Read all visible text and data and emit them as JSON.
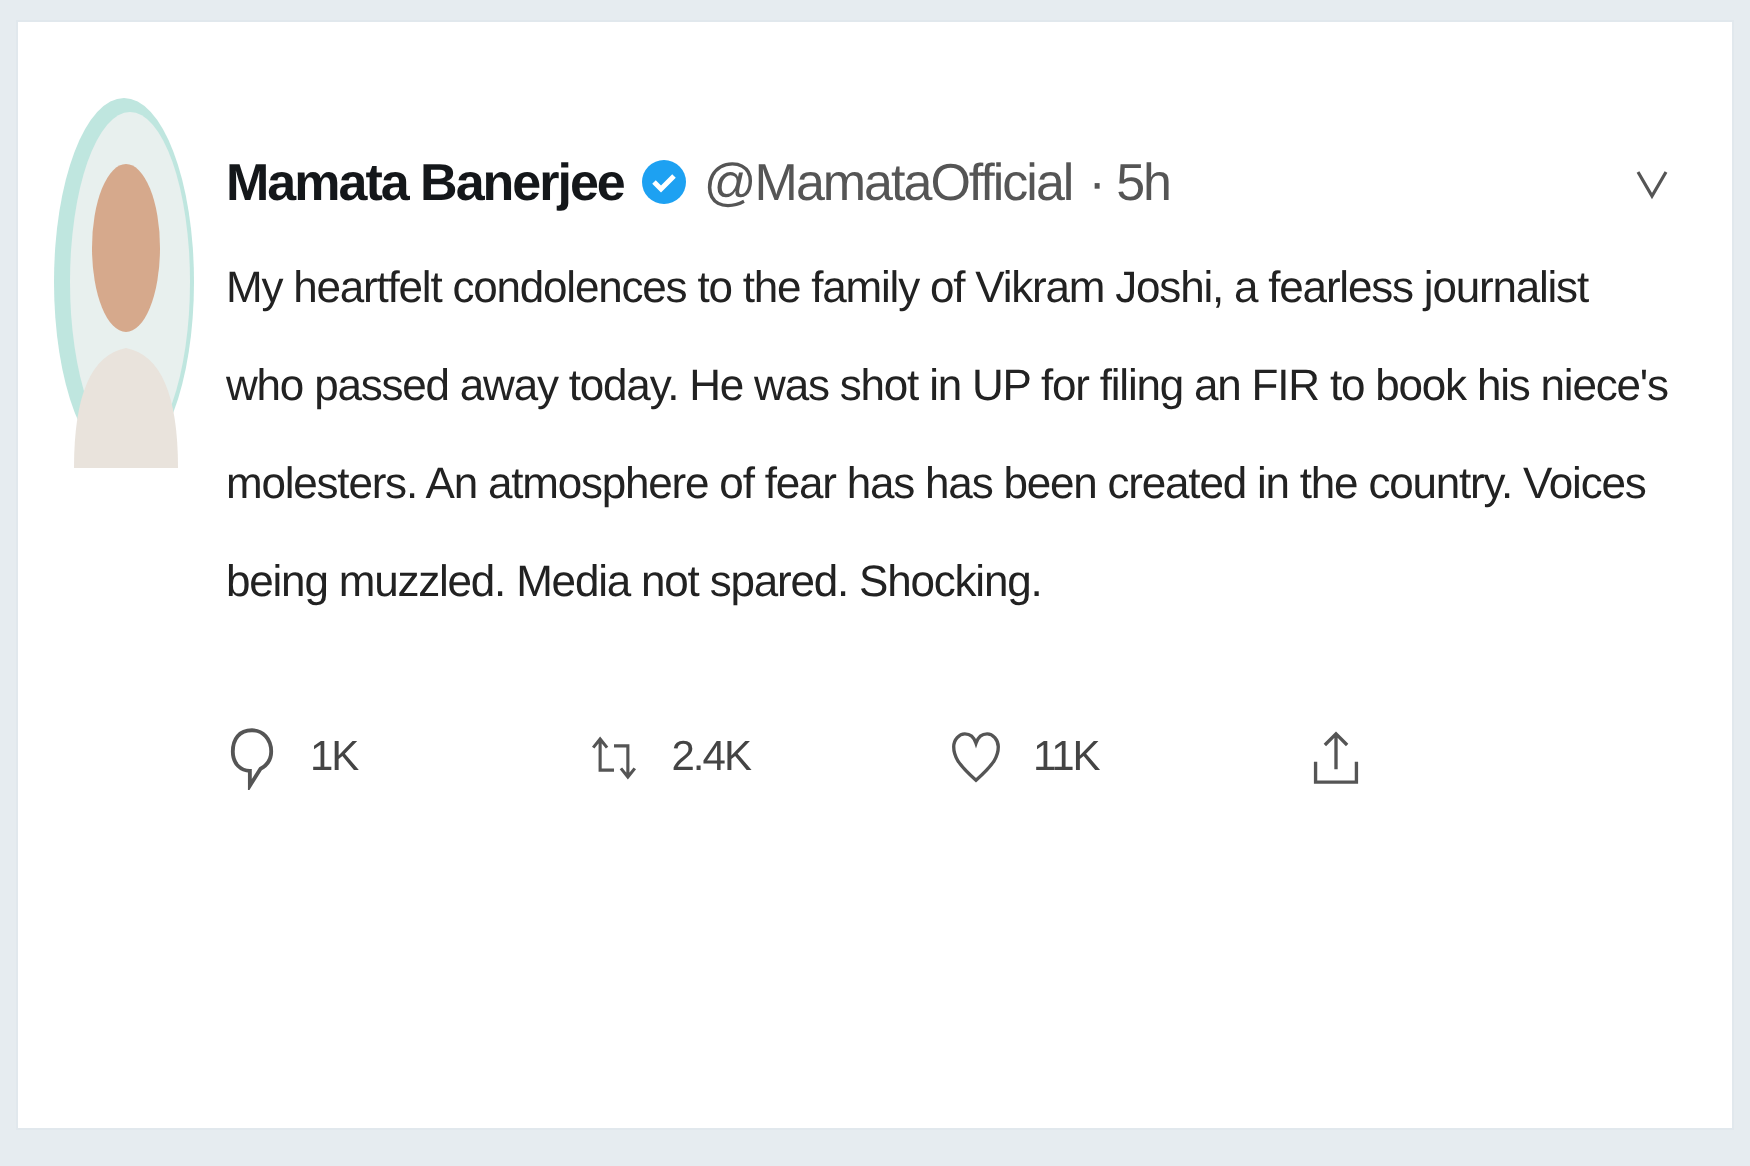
{
  "tweet": {
    "name": "Mamata Banerjee",
    "verified": true,
    "handle": "@MamataOfficial",
    "time": "· 5h",
    "text": "My heartfelt condolences to the family of Vikram Joshi, a fearless journalist who passed away today. He was shot in UP for filing an FIR to book his niece's molesters. An atmosphere of fear has has been created in the country. Voices being muzzled. Media not spared. Shocking.",
    "actions": [
      {
        "kind": "reply",
        "count": "1K"
      },
      {
        "kind": "retweet",
        "count": "2.4K"
      },
      {
        "kind": "like",
        "count": "11K"
      },
      {
        "kind": "share"
      }
    ]
  }
}
